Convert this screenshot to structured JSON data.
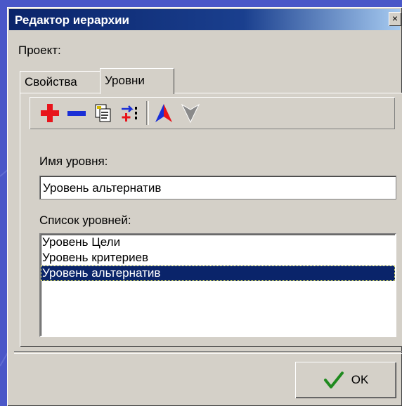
{
  "window": {
    "title": "Редактор иерархии",
    "close_glyph": "×"
  },
  "project": {
    "label": "Проект:"
  },
  "tabs": [
    {
      "label": "Свойства",
      "active": false
    },
    {
      "label": "Уровни",
      "active": true
    }
  ],
  "toolbar": {
    "icons": [
      "add-icon",
      "remove-icon",
      "copy-icon",
      "insert-level-icon",
      "move-up-icon",
      "move-down-icon"
    ]
  },
  "level_name": {
    "label": "Имя уровня:",
    "value": "Уровень альтернатив"
  },
  "levels_list": {
    "label": "Список уровней:",
    "items": [
      "Уровень Цели",
      "Уровень критериев",
      "Уровень альтернатив"
    ],
    "selected_index": 2
  },
  "ok_button": {
    "label": "OK"
  },
  "colors": {
    "selection": "#0a246a",
    "titlebar": "#0a246a",
    "add": "#e8141b",
    "remove": "#1a2fd6"
  }
}
